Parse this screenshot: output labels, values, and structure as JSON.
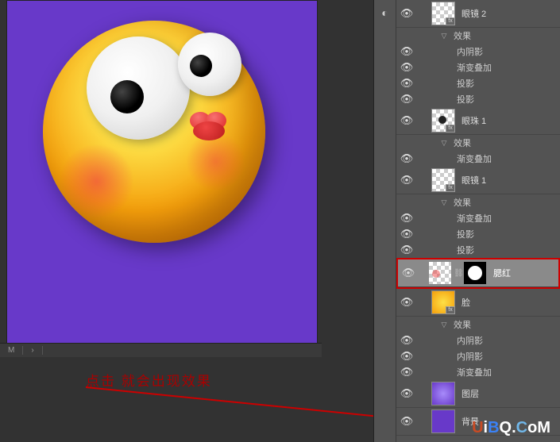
{
  "annotation_text": "点击  就会出现效果",
  "watermark": {
    "u": "U",
    "i": "i",
    "b": "B",
    "q": "Q.",
    "c": "C",
    "o": "o",
    "m": "M"
  },
  "tabbar": {
    "m": "M",
    "arrow": "›"
  },
  "strip": {
    "bw_icon": "◐"
  },
  "vis_icon": "👁",
  "layers": {
    "yanjing2": {
      "name": "眼镜 2",
      "fx_label": "效果",
      "fx_items": [
        "内阴影",
        "渐变叠加",
        "投影",
        "投影"
      ]
    },
    "yanzhu1": {
      "name": "眼珠 1",
      "fx_label": "效果",
      "fx_items": [
        "渐变叠加"
      ]
    },
    "yanjing1": {
      "name": "眼镜 1",
      "fx_label": "效果",
      "fx_items": [
        "渐变叠加",
        "投影",
        "投影"
      ]
    },
    "yanhong": {
      "name": "腮红"
    },
    "lian": {
      "name": "脸",
      "fx_label": "效果",
      "fx_items": [
        "内阴影",
        "内阴影",
        "渐变叠加"
      ]
    },
    "tuceng": {
      "name": "图层"
    },
    "beijing": {
      "name": "背景"
    }
  }
}
